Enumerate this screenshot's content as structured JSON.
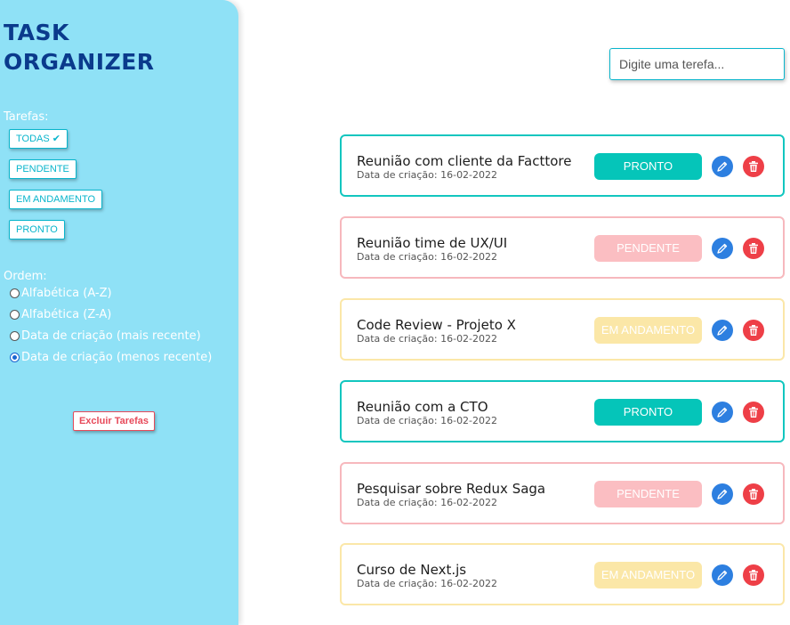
{
  "app": {
    "title_line1": "TASK",
    "title_line2": "ORGANIZER"
  },
  "sidebar": {
    "filter_label": "Tarefas:",
    "filters": [
      {
        "label": "TODAS ✔",
        "selected": true
      },
      {
        "label": "PENDENTE",
        "selected": false
      },
      {
        "label": "EM ANDAMENTO",
        "selected": false
      },
      {
        "label": "PRONTO",
        "selected": false
      }
    ],
    "order_label": "Ordem:",
    "order_options": [
      {
        "label": "Alfabética (A-Z)",
        "checked": false
      },
      {
        "label": "Alfabética (Z-A)",
        "checked": false
      },
      {
        "label": "Data de criação (mais recente)",
        "checked": false
      },
      {
        "label": "Data de criação (menos recente)",
        "checked": true
      }
    ],
    "delete_all_label": "Excluir Tarefas"
  },
  "search": {
    "placeholder": "Digite uma terefa...",
    "value": ""
  },
  "tasks": [
    {
      "title": "Reunião com cliente da Facttore",
      "date": "Data de criação: 16-02-2022",
      "status": "PRONTO",
      "status_key": "pronto"
    },
    {
      "title": "Reunião time de UX/UI",
      "date": "Data de criação: 16-02-2022",
      "status": "PENDENTE",
      "status_key": "pendente"
    },
    {
      "title": "Code Review - Projeto X",
      "date": "Data de criação: 16-02-2022",
      "status": "EM ANDAMENTO",
      "status_key": "andamento"
    },
    {
      "title": "Reunião com a CTO",
      "date": "Data de criação: 16-02-2022",
      "status": "PRONTO",
      "status_key": "pronto"
    },
    {
      "title": "Pesquisar sobre Redux Saga",
      "date": "Data de criação: 16-02-2022",
      "status": "PENDENTE",
      "status_key": "pendente"
    },
    {
      "title": "Curso de Next.js",
      "date": "Data de criação: 16-02-2022",
      "status": "EM ANDAMENTO",
      "status_key": "andamento"
    }
  ],
  "colors": {
    "sidebar_bg": "#8fe1f6",
    "title": "#0a3a8c",
    "accent": "#08b5cc",
    "pronto": "#05c5b9",
    "pendente": "#fbbec2",
    "andamento": "#fbe7a7",
    "edit": "#2d7fe0",
    "delete": "#ee3f47"
  },
  "icons": {
    "edit": "pencil-icon",
    "delete": "trash-icon"
  }
}
